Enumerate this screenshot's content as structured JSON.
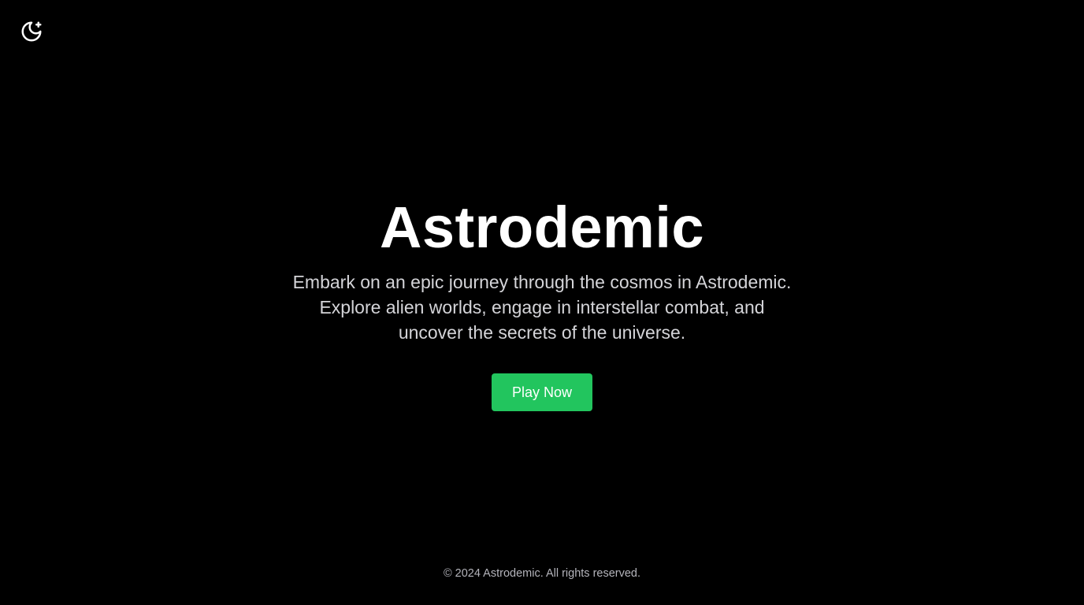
{
  "header": {
    "theme_toggle_icon": "moon-sparkle-icon",
    "icon_color": "#ffffff"
  },
  "hero": {
    "title": "Astrodemic",
    "tagline": "Embark on an epic journey through the cosmos in Astrodemic. Explore alien worlds, engage in interstellar combat, and uncover the secrets of the universe.",
    "cta_label": "Play Now",
    "cta_color": "#22c55e"
  },
  "footer": {
    "copyright": "© 2024 Astrodemic. All rights reserved."
  },
  "colors": {
    "background": "#000000",
    "title": "#ffffff",
    "tagline": "#d4d4d8",
    "footer_text": "#b4b4bb"
  }
}
